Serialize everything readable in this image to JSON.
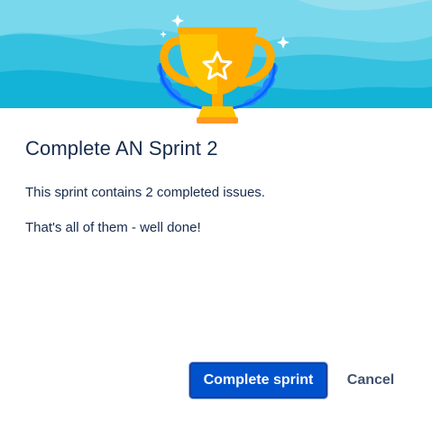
{
  "dialog": {
    "title": "Complete AN Sprint 2",
    "summary": "This sprint contains 2 completed issues.",
    "message": "That's all of them - well done!",
    "primary_action": "Complete sprint",
    "secondary_action": "Cancel"
  },
  "illustration": {
    "icon": "trophy-icon",
    "colors": {
      "sky_light": "#a7e3f0",
      "sky_mid": "#5ccfe6",
      "sky_deep": "#12b3d6",
      "trophy_gold": "#ffab00",
      "trophy_light": "#ffc400",
      "laurel_blue": "#2684ff"
    }
  },
  "theme": {
    "primary_button_bg": "#0052cc",
    "text_color": "#172b4d",
    "secondary_text_color": "#42526e"
  }
}
